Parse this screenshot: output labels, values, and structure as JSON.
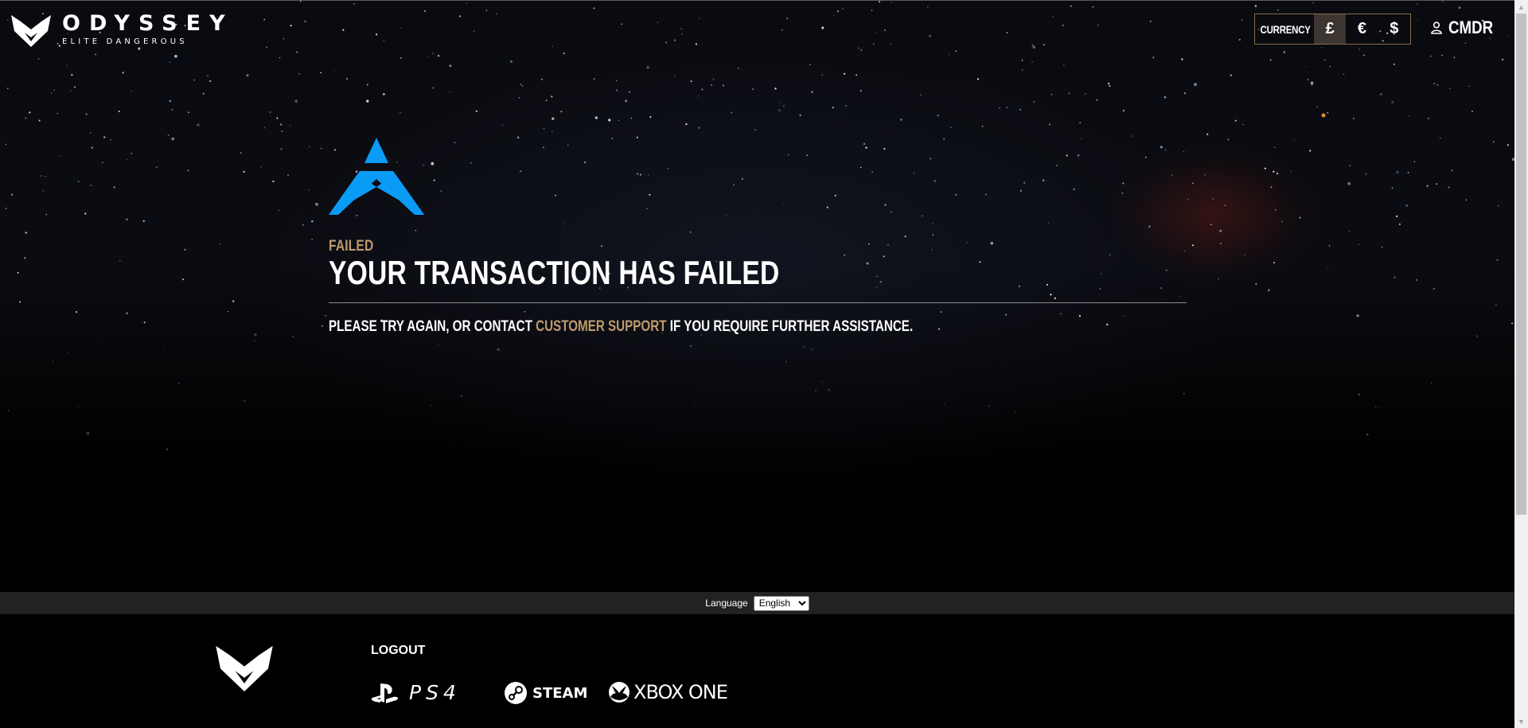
{
  "header": {
    "brand": {
      "name": "ODYSSEY",
      "subtitle": "ELITE DANGEROUS"
    },
    "currency": {
      "label": "CURRENCY",
      "options": [
        "£",
        "€",
        "$"
      ],
      "selected": "£"
    },
    "account": {
      "label": "CMDR",
      "icon": "user-icon"
    }
  },
  "main": {
    "icon": "failed-triangle-icon",
    "status": "FAILED",
    "title": "YOUR TRANSACTION HAS FAILED",
    "message": {
      "before": "PLEASE TRY AGAIN, OR CONTACT ",
      "link": "CUSTOMER SUPPORT",
      "after": " IF YOU REQUIRE FURTHER ASSISTANCE."
    }
  },
  "language_bar": {
    "label": "Language",
    "selected": "English"
  },
  "footer": {
    "logout": "LOGOUT",
    "platforms": [
      {
        "name": "PS4",
        "icon": "playstation-icon"
      },
      {
        "name": "STEAM",
        "icon": "steam-icon"
      },
      {
        "name": "XBOX ONE",
        "icon": "xbox-icon"
      }
    ]
  },
  "colors": {
    "accent": "#c09a6b",
    "icon_blue": "#0a9cf5",
    "background": "#000000",
    "language_bar": "#222222"
  }
}
